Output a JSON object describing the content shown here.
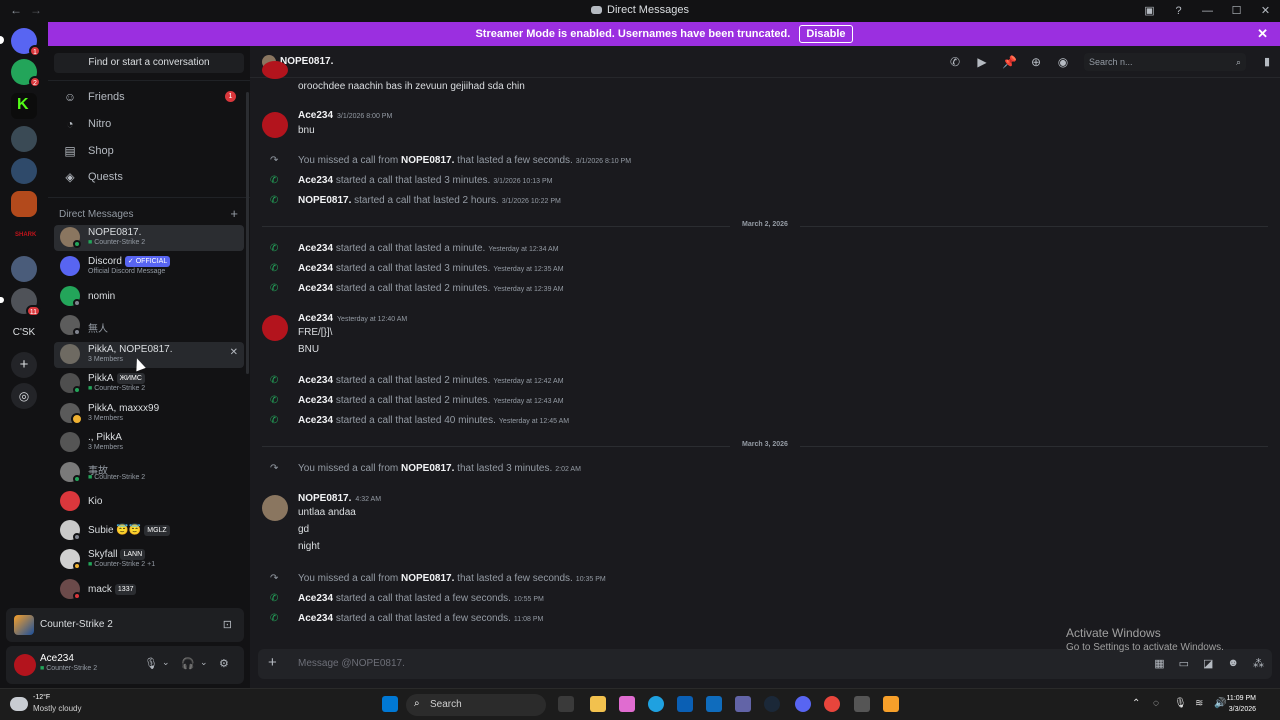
{
  "window": {
    "title": "Direct Messages"
  },
  "banner": {
    "text": "Streamer Mode is enabled. Usernames have been truncated.",
    "button": "Disable"
  },
  "servers": {
    "badges": [
      "1",
      "2",
      "11"
    ],
    "text_server": "C'SK"
  },
  "sidebar": {
    "find_placeholder": "Find or start a conversation",
    "nav": [
      {
        "label": "Friends",
        "icon": "friends-icon",
        "badge": "1"
      },
      {
        "label": "Nitro",
        "icon": "nitro-icon"
      },
      {
        "label": "Shop",
        "icon": "shop-icon"
      },
      {
        "label": "Quests",
        "icon": "quests-icon"
      }
    ],
    "dm_header": "Direct Messages",
    "dms": [
      {
        "name": "NOPE0817.",
        "sub": "Counter-Strike 2"
      },
      {
        "name": "Discord",
        "tag": "OFFICIAL",
        "sub": "Official Discord Message"
      },
      {
        "name": "nomin"
      },
      {
        "name": "無人"
      },
      {
        "name": "PikkA, NOPE0817.",
        "sub": "3 Members"
      },
      {
        "name": "PikkA",
        "tag": "ЖИМС",
        "sub": "Counter-Strike 2"
      },
      {
        "name": "PikkA, maxxx99",
        "sub": "3 Members"
      },
      {
        "name": "., PikkA",
        "sub": "3 Members"
      },
      {
        "name": "事故",
        "sub": "Counter-Strike 2"
      },
      {
        "name": "Kio"
      },
      {
        "name": "Subie",
        "tag": "MGLZ"
      },
      {
        "name": "Skyfall",
        "tag": "LANN",
        "sub": "Counter-Strike 2 +1"
      },
      {
        "name": "mack",
        "tag": "1337"
      }
    ]
  },
  "activity": {
    "game": "Counter-Strike 2"
  },
  "user": {
    "name": "Ace234",
    "status": "Counter-Strike 2"
  },
  "chat": {
    "recipient": "NOPE0817.",
    "search_placeholder": "Search n...",
    "composer_placeholder": "Message @NOPE0817."
  },
  "messages": {
    "m0": {
      "text": "oroochdee naachin bas ih zevuun gejiihad sda chin"
    },
    "m1": {
      "author": "Ace234",
      "time": "3/1/2026 8:00 PM",
      "text": "bnu"
    },
    "s1": {
      "prefix": "You missed a call from",
      "who": "NOPE0817.",
      "suffix": "that lasted a few seconds.",
      "time": "3/1/2026 8:10 PM"
    },
    "s2": {
      "who": "Ace234",
      "suffix": "started a call that lasted 3 minutes.",
      "time": "3/1/2026 10:13 PM"
    },
    "s3": {
      "who": "NOPE0817.",
      "suffix": "started a call that lasted 2 hours.",
      "time": "3/1/2026 10:22 PM"
    },
    "d1": "March 2, 2026",
    "s4": {
      "who": "Ace234",
      "suffix": "started a call that lasted a minute.",
      "time": "Yesterday at 12:34 AM"
    },
    "s5": {
      "who": "Ace234",
      "suffix": "started a call that lasted 3 minutes.",
      "time": "Yesterday at 12:35 AM"
    },
    "s6": {
      "who": "Ace234",
      "suffix": "started a call that lasted 2 minutes.",
      "time": "Yesterday at 12:39 AM"
    },
    "m2": {
      "author": "Ace234",
      "time": "Yesterday at 12:40 AM",
      "line1": "FRE/[}]\\",
      "line2": "BNU"
    },
    "s7": {
      "who": "Ace234",
      "suffix": "started a call that lasted 2 minutes.",
      "time": "Yesterday at 12:42 AM"
    },
    "s8": {
      "who": "Ace234",
      "suffix": "started a call that lasted 2 minutes.",
      "time": "Yesterday at 12:43 AM"
    },
    "s9": {
      "who": "Ace234",
      "suffix": "started a call that lasted 40 minutes.",
      "time": "Yesterday at 12:45 AM"
    },
    "d2": "March 3, 2026",
    "s10": {
      "prefix": "You missed a call from",
      "who": "NOPE0817.",
      "suffix": "that lasted 3 minutes.",
      "time": "2:02 AM"
    },
    "m3": {
      "author": "NOPE0817.",
      "time": "4:32 AM",
      "line1": "untlaa andaa",
      "line2": "gd",
      "line3": "night"
    },
    "s11": {
      "prefix": "You missed a call from",
      "who": "NOPE0817.",
      "suffix": "that lasted a few seconds.",
      "time": "10:35 PM"
    },
    "s12": {
      "who": "Ace234",
      "suffix": "started a call that lasted a few seconds.",
      "time": "10:55 PM"
    },
    "s13": {
      "who": "Ace234",
      "suffix": "started a call that lasted a few seconds.",
      "time": "11:08 PM"
    }
  },
  "watermark": {
    "title": "Activate Windows",
    "sub": "Go to Settings to activate Windows."
  },
  "taskbar": {
    "temp": "-12°F",
    "weather": "Mostly cloudy",
    "search": "Search",
    "time": "11:09 PM",
    "date": "3/3/2026"
  }
}
